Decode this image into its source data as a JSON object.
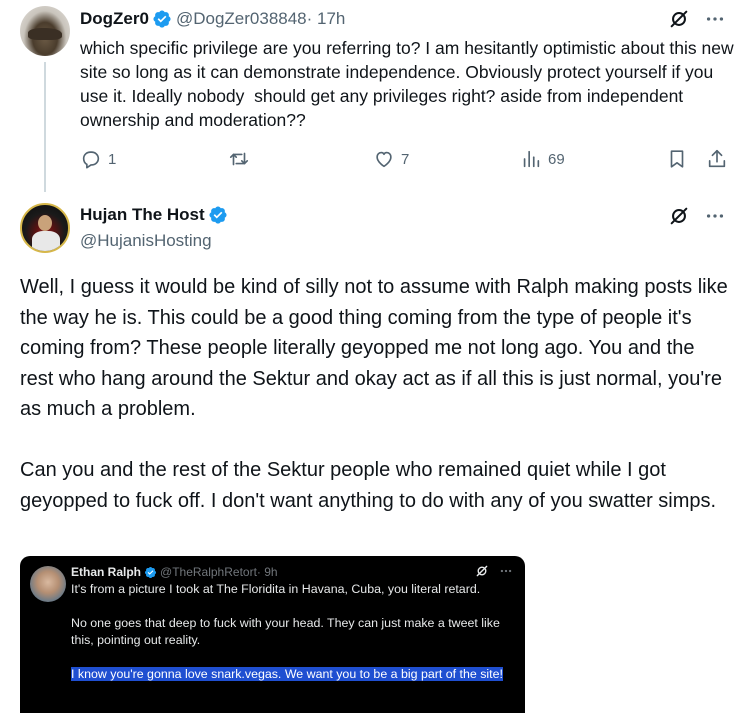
{
  "tweet1": {
    "display_name": "DogZer0",
    "handle": "@DogZer038848",
    "time": " · 17h",
    "text": "which specific privilege are you referring to? I am hesitantly optimistic about this new site so long as it can demonstrate independence. Obviously protect yourself if you use it. Ideally nobody  should get any privileges right? aside from independent ownership and moderation??",
    "reply_count": "1",
    "like_count": "7",
    "view_count": "69"
  },
  "tweet2": {
    "display_name": "Hujan The Host",
    "handle": "@HujanisHosting",
    "paragraph1": "Well, I guess it would be kind of silly not to assume with Ralph making posts like the way he is. This could be a good thing coming from the type of people it's coming from? These people literally geyopped me not long ago. You and the rest who hang around the Sektur and okay act as if all this is just normal, you're as much a problem.",
    "paragraph2": "Can you and the rest of the Sektur people who remained quiet while I got geyopped to fuck off. I don't want anything to do with any of you swatter simps."
  },
  "embedded": {
    "display_name": "Ethan Ralph",
    "handle": "@TheRalphRetort",
    "time": " · 9h",
    "paragraph1": "It's from a picture I took at The Floridita in Havana, Cuba, you literal retard.",
    "paragraph2": "No one goes that deep to fuck with your head. They can just make a tweet like this, pointing out reality.",
    "paragraph3": "I know you're gonna love snark.vegas. We want you to be a big part of the site!"
  },
  "colors": {
    "verified": "#1d9bf0",
    "muted_text": "#536471",
    "thread_line": "#cfd9de",
    "highlight": "#1f4fd1"
  },
  "icons": [
    "verified-badge-icon",
    "grok-icon",
    "more-icon",
    "reply-icon",
    "retweet-icon",
    "like-icon",
    "views-icon",
    "bookmark-icon",
    "share-icon"
  ]
}
